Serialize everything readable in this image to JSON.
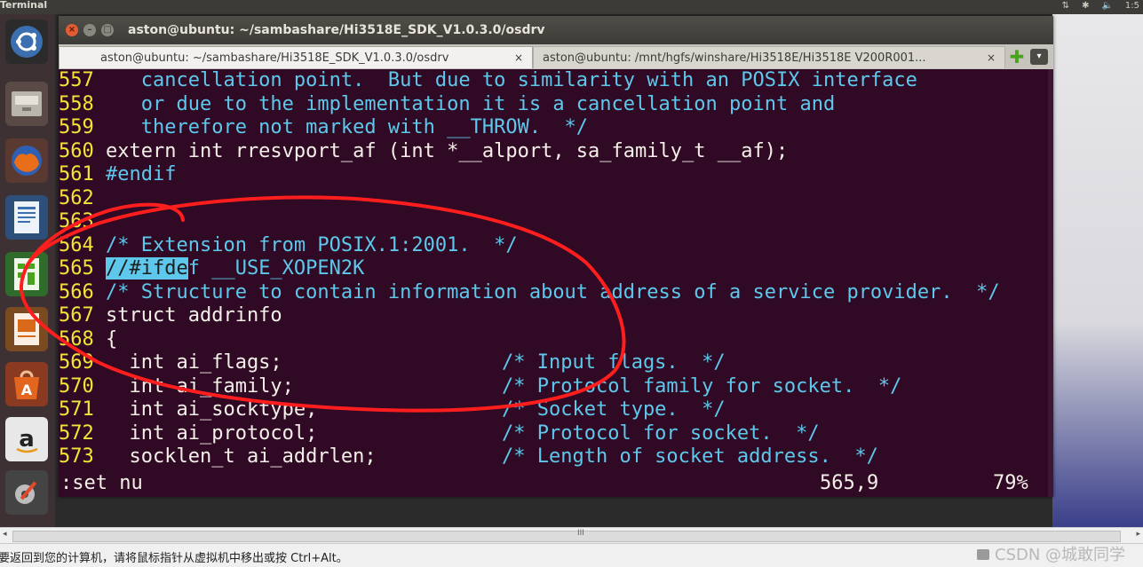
{
  "top_panel": {
    "title": "Terminal",
    "clock": "1:5"
  },
  "window": {
    "title": "aston@ubuntu: ~/sambashare/Hi3518E_SDK_V1.0.3.0/osdrv",
    "tabs": [
      {
        "label": "aston@ubuntu: ~/sambashare/Hi3518E_SDK_V1.0.3.0/osdrv",
        "active": true,
        "close": "×"
      },
      {
        "label": "aston@ubuntu: /mnt/hgfs/winshare/Hi3518E/Hi3518E V200R001...",
        "active": false,
        "close": "×"
      }
    ],
    "add_tab": "✚",
    "menu": "▾"
  },
  "editor": {
    "lines": [
      {
        "num": "557",
        "text": "   cancellation point.  But due to similarity with an POSIX interface",
        "style": "comment"
      },
      {
        "num": "558",
        "text": "   or due to the implementation it is a cancellation point and",
        "style": "comment"
      },
      {
        "num": "559",
        "text": "   therefore not marked with __THROW.  */",
        "style": "comment"
      },
      {
        "num": "560",
        "text": "extern int rresvport_af (int *__alport, sa_family_t __af);",
        "style": "code"
      },
      {
        "num": "561",
        "text": "#endif",
        "style": "comment"
      },
      {
        "num": "562",
        "text": "",
        "style": "code"
      },
      {
        "num": "563",
        "text": "",
        "style": "code"
      },
      {
        "num": "564",
        "text": "/* Extension from POSIX.1:2001.  */",
        "style": "comment"
      },
      {
        "num": "565",
        "text_hl": "//#ifde",
        "text_rest": "f __USE_XOPEN2K",
        "style": "highlight"
      },
      {
        "num": "566",
        "text": "/* Structure to contain information about address of a service provider.  */",
        "style": "comment"
      },
      {
        "num": "567",
        "text": "struct addrinfo",
        "style": "code"
      },
      {
        "num": "568",
        "text": "{",
        "style": "code"
      },
      {
        "num": "569",
        "code": "  int ai_flags;",
        "comment": "/* Input flags.  */"
      },
      {
        "num": "570",
        "code": "  int ai_family;",
        "comment": "/* Protocol family for socket.  */"
      },
      {
        "num": "571",
        "code": "  int ai_socktype;",
        "comment": "/* Socket type.  */"
      },
      {
        "num": "572",
        "code": "  int ai_protocol;",
        "comment": "/* Protocol for socket.  */"
      },
      {
        "num": "573",
        "code": "  socklen_t ai_addrlen;",
        "comment": "/* Length of socket address.  */"
      }
    ],
    "status_command": ":set nu",
    "status_position": "565,9",
    "status_percent": "79%"
  },
  "host": {
    "message": "要返回到您的计算机，请将鼠标指针从虚拟机中移出或按 Ctrl+Alt。",
    "watermark": "CSDN @城敢同学",
    "scroll_grip": "III"
  },
  "colors": {
    "terminal_bg": "#300a24",
    "line_number": "#f3e437",
    "comment": "#5ec8ec",
    "annotation": "#ff1e1e"
  }
}
